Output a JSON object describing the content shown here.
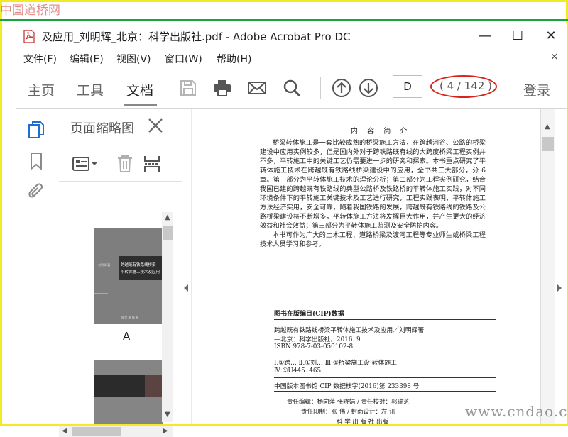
{
  "watermarks": {
    "top_left": "中国道桥网",
    "bottom_right": "www.cndao.com"
  },
  "window": {
    "title": "及应用_刘明辉_北京：科学出版社.pdf - Adobe Acrobat Pro DC",
    "controls": {
      "minimize": "—",
      "maximize": "☐",
      "close": "✕"
    }
  },
  "menu": {
    "items": [
      "文件(F)",
      "编辑(E)",
      "视图(V)",
      "窗口(W)",
      "帮助(H)"
    ],
    "close": "×"
  },
  "toolbar": {
    "tabs": [
      "主页",
      "工具",
      "文档"
    ],
    "active_tab": "文档",
    "page_input": "D",
    "page_count": "( 4 / 142 )",
    "login": "登录"
  },
  "thumbnail_panel": {
    "title": "页面缩略图",
    "thumb1": {
      "title_line1": "跨越既有铁路线桥梁",
      "title_line2": "平转体施工技术及应用",
      "author": "刘明辉 著",
      "publisher": "科 学 出 版 社",
      "label": "A"
    }
  },
  "page": {
    "heading": "内 容 简 介",
    "body": [
      "桥梁转体施工是一套比较成熟的桥梁施工方法，在跨越河谷、公路的桥梁建设中应用实例较多，但是国内外对于跨铁路既有线的大跨度桥梁工程实例并不多，平转施工中的关键工艺仍需要进一步的研究和探索。本书重点研究了平转体施工技术在跨越既有铁路线桥梁建设中的应用，全书共三大部分，分 6 章。第一部分为平转体施工技术的理论分析；第二部分为工程实例研究，结合我国已建的跨越既有铁路线的典型公路桥及铁路桥的平转体施工实践，对不同环境条件下的平转施工关键技术及工艺进行研究，工程实践表明，平转体施工方法经济实用，安全可靠，随着我国铁路的发展，跨越既有铁路线的铁路及公路桥梁建设将不断增多，平转体施工方法将发挥巨大作用，并产生更大的经济效益和社会效益；第三部分为平转体施工监测及安全防护内容。",
      "本书可作为广大的土木工程、道路桥梁及渡河工程等专业师生或桥梁工程技术人员学习和参考。"
    ],
    "cip": {
      "heading": "图书在版编目(CIP)数据",
      "line1": "跨越既有铁路线桥梁平转体施工技术及应用／刘明辉著.",
      "line2": "—北京：科学出版社，2016. 9",
      "line3": "ISBN 978-7-03-050102-8",
      "line4": "Ⅰ.①跨…  Ⅱ.①刘…  Ⅲ.①桥梁施工设-转体施工",
      "line5": "Ⅳ.①U445. 465",
      "line6": "中国版本图书馆 CIP 数据核字(2016)第 233398 号"
    },
    "credits": {
      "line1": "责任编辑：杨向萍   张晓娟 / 责任校对：郭瑞芝",
      "line2": "责任印制：张   伟 / 封面设计：左   讯",
      "publisher": "科 学 出 版 社   出版"
    }
  }
}
